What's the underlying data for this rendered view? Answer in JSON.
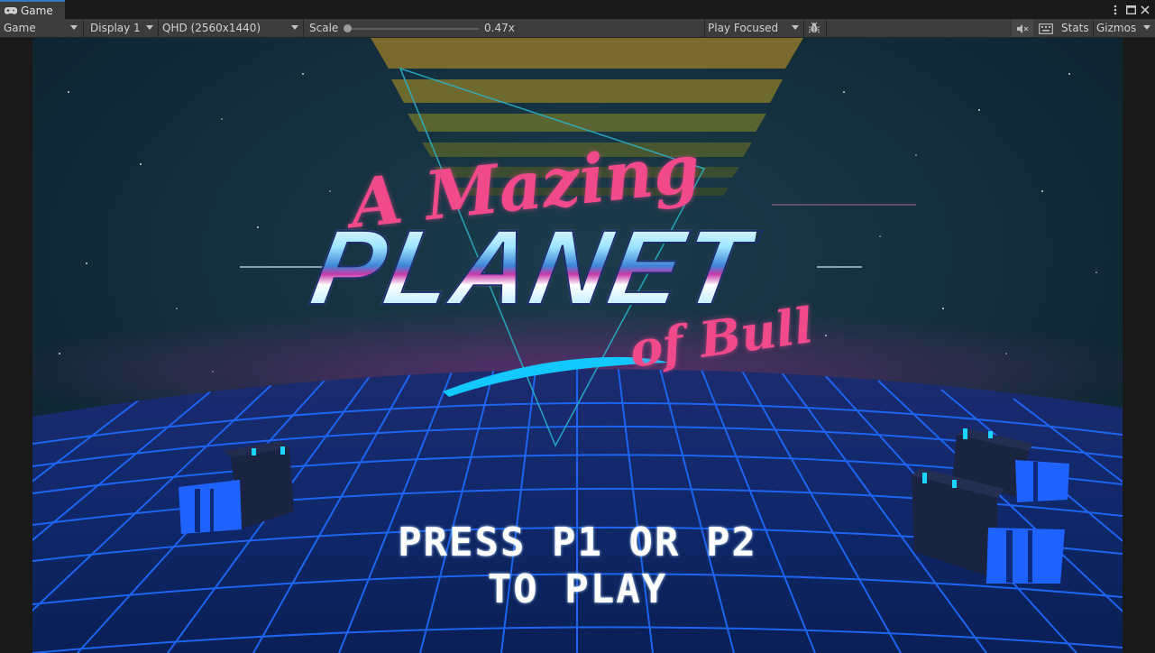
{
  "tab": {
    "title": "Game",
    "icon": "gamepad-icon"
  },
  "window_controls": {
    "menu_icon": "kebab-menu-icon",
    "maximize_icon": "maximize-icon",
    "close_icon": "close-icon"
  },
  "toolbar": {
    "view_mode": "Game",
    "display": "Display 1",
    "resolution": "QHD (2560x1440)",
    "scale_label": "Scale",
    "scale_value": "0.47x",
    "scale_fraction": 0.0,
    "play_mode": "Play Focused",
    "bug_icon": "bug-icon",
    "mute_icon": "mute-audio-icon",
    "keyboard_icon": "keyboard-shortcuts-icon",
    "stats_label": "Stats",
    "gizmos_label": "Gizmos"
  },
  "game": {
    "title_line1": "A Mazing",
    "title_line2": "PLANET",
    "title_line3": "of Bull",
    "prompt_line1": "PRESS P1 OR P2",
    "prompt_line2": "TO PLAY",
    "colors": {
      "grid": "#1e6cff",
      "neon_pink": "#f04a8a",
      "neon_cyan": "#12c8ff",
      "sky": "#0f2633"
    }
  }
}
